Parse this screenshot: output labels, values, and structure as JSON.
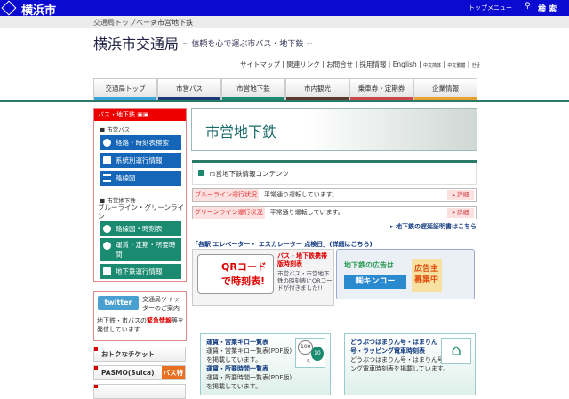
{
  "topbar": {
    "logo": "横浜市",
    "top_menu": "トップメニュー",
    "search": "検 索"
  },
  "breadcrumb": {
    "home": "交通局トップページ",
    "sep": ">",
    "current": "市営地下鉄"
  },
  "site": {
    "title": "横浜市交通局",
    "tagline": "~ 信頼を心で運ぶ市バス・地下鉄 ~"
  },
  "links": [
    "サイトマップ",
    "関連リンク",
    "お問合せ",
    "採用情報",
    "English",
    "中文简体",
    "中文繁體",
    "한글"
  ],
  "nav": [
    {
      "label": "交通局トップ",
      "color": "#3aa6d8"
    },
    {
      "label": "市営バス",
      "color": "#1a3a7a"
    },
    {
      "label": "市営地下鉄",
      "color": "#1a8a70"
    },
    {
      "label": "市内観光",
      "color": "#5a3a2a"
    },
    {
      "label": "乗車券・定期券",
      "color": "#c84a4a"
    },
    {
      "label": "企業情報",
      "color": "#e8a030"
    }
  ],
  "sidebar": {
    "header": "バス・地下鉄",
    "bus_section": "市営バス",
    "bus_items": [
      "経路・時刻表検索",
      "系統別運行情報",
      "路線図"
    ],
    "subway_section": "市営地下鉄",
    "subway_lines": "ブルーライン・グリーンライン",
    "subway_items": [
      "路線図・時刻表",
      "運賃・定期・所要時間",
      "地下鉄運行情報"
    ]
  },
  "twitter": {
    "logo": "twitter",
    "text": "交通局ツイッターのご案内",
    "note_pre": "地下鉄・市バスの",
    "note_em": "緊急情報",
    "note_post": "等を発信しています"
  },
  "tickets": [
    "おトクなチケット",
    "PASMO(Suica)",
    "バス特"
  ],
  "main": {
    "page_title": "市営地下鉄",
    "info_heading": "市営地下鉄情報コンテンツ",
    "status": [
      {
        "line": "ブルーライン運行状況",
        "text": "平常通り運転しています。",
        "detail": "▸ 詳細"
      },
      {
        "line": "グリーンライン運行状況",
        "text": "平常通り運転しています。",
        "detail": "▸ 詳細"
      }
    ],
    "delay_link": "▸ 地下鉄の遅延証明書はこちら",
    "elevator_link": "「各駅 エレベーター・ エスカレーター 点検日」(詳細はこちら)",
    "qr": {
      "image_text": "QRコードで時刻表!",
      "title": "バス・地下鉄携帯版時刻表",
      "desc": "市営バス・市営地下鉄の時刻表にQRコードが付きました!!"
    },
    "ad": {
      "line1": "地下鉄の広告は",
      "line2": "㈱キンコー",
      "recruit": "広告主募集中"
    },
    "box1": {
      "t1": "運賃・営業キロ一覧表",
      "d1": "運賃・営業キロ一覧表(PDF版)を掲載しています。",
      "t2": "運賃・所要時間一覧表",
      "d2": "運賃・所要時間一覧表(PDF版)を掲載しています。",
      "coins": [
        "100",
        "10",
        "5"
      ]
    },
    "box2": {
      "t1": "どうぶつはまりん号・はまりん号・ラッピング電車時刻表",
      "d1": "どうぶつはまりん号・はまりん号・ラッピング電車時刻表を掲載しています。"
    }
  }
}
